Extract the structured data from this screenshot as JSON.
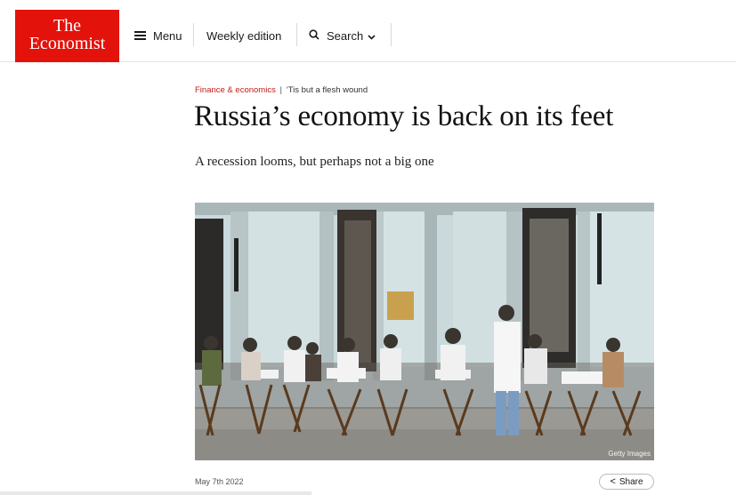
{
  "header": {
    "logo_line1": "The",
    "logo_line2": "Economist",
    "menu_label": "Menu",
    "weekly_label": "Weekly edition",
    "search_label": "Search"
  },
  "article": {
    "section": "Finance & economics",
    "kicker_separator": "|",
    "fly_title": "’Tis but a flesh wound",
    "headline": "Russia’s economy is back on its feet",
    "subheadline": "A recession looms, but perhaps not a big one",
    "image_credit": "Getty Images",
    "date": "May 7th 2022",
    "share_label": "Share"
  },
  "colors": {
    "brand_red": "#e3120b",
    "section_red": "#c01d17"
  },
  "icons": [
    "menu-icon",
    "search-icon",
    "chevron-down-icon",
    "share-icon"
  ]
}
